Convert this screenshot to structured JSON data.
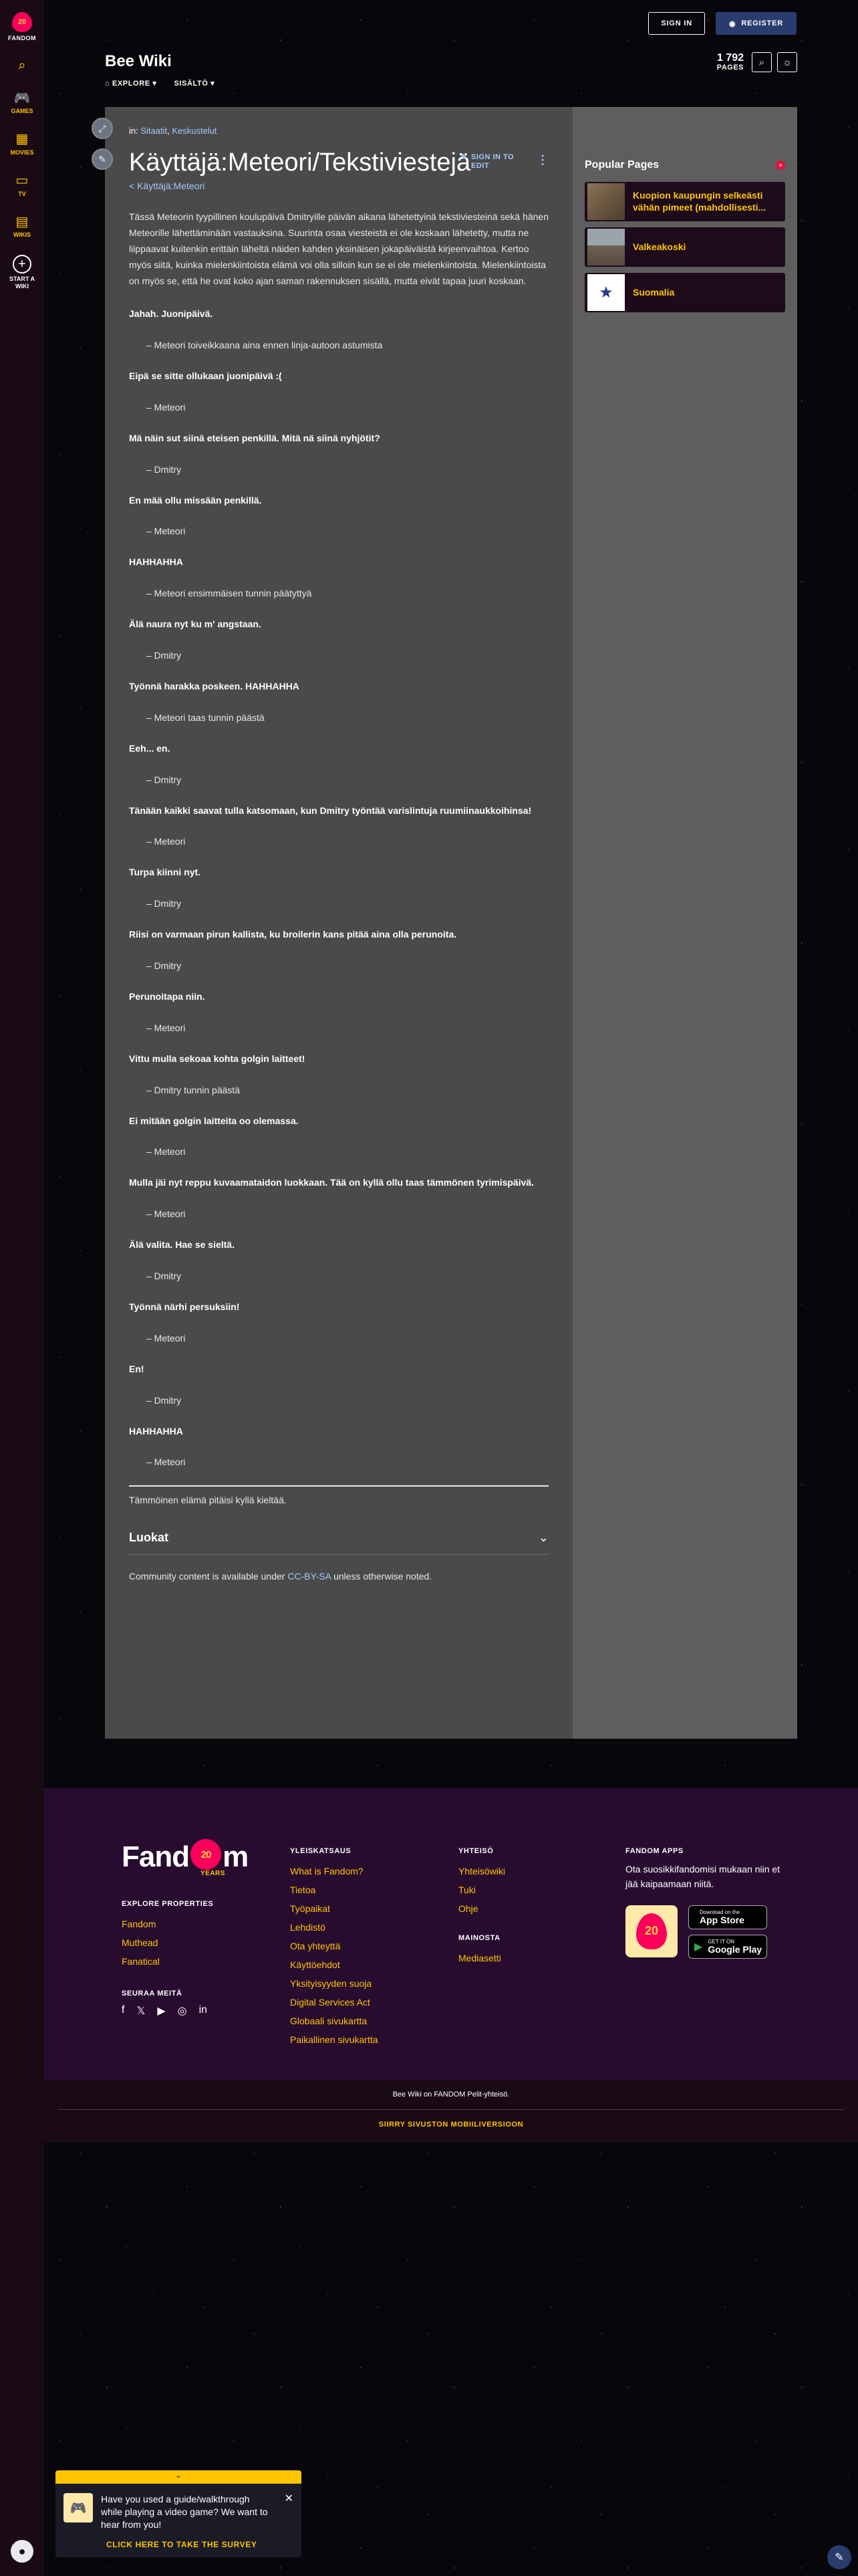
{
  "rail": {
    "logo_label": "FANDOM",
    "logo_badge": "20",
    "items": [
      {
        "label": "",
        "icon": "search-icon",
        "glyph": "⌕"
      },
      {
        "label": "GAMES",
        "icon": "gamepad-icon",
        "glyph": "🎮"
      },
      {
        "label": "MOVIES",
        "icon": "movies-icon",
        "glyph": "▦"
      },
      {
        "label": "TV",
        "icon": "tv-icon",
        "glyph": "▭"
      },
      {
        "label": "WIKIS",
        "icon": "wikis-icon",
        "glyph": "▤"
      }
    ],
    "start_label_1": "START A",
    "start_label_2": "WIKI",
    "start_glyph": "+"
  },
  "auth": {
    "signin": "SIGN IN",
    "register": "REGISTER"
  },
  "wiki": {
    "name": "Bee Wiki",
    "nav_explore": "EXPLORE ▾",
    "nav_content": "SISÄLTÖ ▾",
    "pages_num": "1 792",
    "pages_word": "PAGES"
  },
  "article": {
    "in_label": "in:",
    "cat1": "Sitaatit",
    "cat2": "Keskustelut",
    "title": "Käyttäjä:Meteori/Tekstiviestejä",
    "edit_label": "SIGN IN TO EDIT",
    "back_link": "< Käyttäjä:Meteori",
    "intro": "Tässä Meteorin tyypillinen koulupäivä Dmitryille päivän aikana lähetettyinä tekstiviesteinä sekä hänen Meteorille lähettäminään vastauksina. Suurinta osaa viesteistä ei ole koskaan lähetetty, mutta ne liippaavat kuitenkin erittäin läheltä näiden kahden yksinäisen jokapäiväistä kirjeenvaihtoa. Kertoo myös siitä, kuinka mielenkiintoista elämä voi olla silloin kun se ei ole mielenkiintoista. Mielenkiintoista on myös se, että he ovat koko ajan saman rakennuksen sisällä, mutta eivät tapaa juuri koskaan.",
    "dialogue": [
      {
        "q": "Jahah. Juonipäivä.",
        "a": "– Meteori toiveikkaana aina ennen linja-autoon astumista"
      },
      {
        "q": "Eipä se sitte ollukaan juonipäivä :(",
        "a": "– Meteori"
      },
      {
        "q": "Mä näin sut siinä eteisen penkillä. Mitä nä siinä nyhjötit?",
        "a": "– Dmitry"
      },
      {
        "q": "En mää ollu missään penkillä.",
        "a": "– Meteori"
      },
      {
        "q": "HAHHAHHA",
        "a": "– Meteori ensimmäisen tunnin päätyttyä"
      },
      {
        "q": "Älä naura nyt ku m' angstaan.",
        "a": "– Dmitry"
      },
      {
        "q": "Työnnä harakka poskeen. HAHHAHHA",
        "a": "– Meteori taas tunnin päästä"
      },
      {
        "q": "Eeh... en.",
        "a": "– Dmitry"
      },
      {
        "q": "Tänään kaikki saavat tulla katsomaan, kun Dmitry työntää varislintuja ruumiinaukkoihinsa!",
        "a": "– Meteori"
      },
      {
        "q": "Turpa kiinni nyt.",
        "a": "– Dmitry"
      },
      {
        "q": "Riisi on varmaan pirun kallista, ku broilerin kans pitää aina olla perunoita.",
        "a": "– Dmitry"
      },
      {
        "q": "Perunoitapa niin.",
        "a": "– Meteori"
      },
      {
        "q": "Vittu mulla sekoaa kohta golgin laitteet!",
        "a": "– Dmitry tunnin päästä"
      },
      {
        "q": "Ei mitään golgin laitteita oo olemassa.",
        "a": "– Meteori"
      },
      {
        "q": "Mulla jäi nyt reppu kuvaamataidon luokkaan. Tää on kyllä ollu taas tämmönen tyrimispäivä.",
        "a": "– Meteori"
      },
      {
        "q": "Älä valita. Hae se sieltä.",
        "a": "– Dmitry"
      },
      {
        "q": "Työnnä närhi persuksiin!",
        "a": "– Meteori"
      },
      {
        "q": "En!",
        "a": "– Dmitry"
      },
      {
        "q": "HAHHAHHA",
        "a": "– Meteori"
      }
    ],
    "outro": "Tämmöinen elämä pitäisi kyllä kieltää.",
    "categories_heading": "Luokat",
    "license_pre": "Community content is available under ",
    "license_link": "CC-BY-SA",
    "license_post": " unless otherwise noted."
  },
  "popular": {
    "title": "Popular Pages",
    "items": [
      {
        "label": "Kuopion kaupungin selkeästi vähän pimeet (mahdollisesti...",
        "thumb_color": "#6b5a44"
      },
      {
        "label": "Valkeakoski",
        "thumb_color": "#7a6a58"
      },
      {
        "label": "Suomalia",
        "thumb_color": "#ffffff"
      }
    ]
  },
  "footer": {
    "logo": "Fandom",
    "logo_badge": "20",
    "years": "YEARS",
    "explore_h": "EXPLORE PROPERTIES",
    "explore": [
      "Fandom",
      "Muthead",
      "Fanatical"
    ],
    "follow_h": "SEURAA MEITÄ",
    "overview_h": "YLEISKATSAUS",
    "overview": [
      "What is Fandom?",
      "Tietoa",
      "Työpaikat",
      "Lehdistö",
      "Ota yhteyttä",
      "Käyttöehdot",
      "Yksityisyyden suoja",
      "Digital Services Act",
      "Globaali sivukartta",
      "Paikallinen sivukartta"
    ],
    "community_h": "YHTEISÖ",
    "community": [
      "Yhteisöwiki",
      "Tuki",
      "Ohje"
    ],
    "advertise_h": "MAINOSTA",
    "advertise": [
      "Mediasetti"
    ],
    "apps_h": "FANDOM APPS",
    "apps_text": "Ota suosikkifandomisi mukaan niin et jää kaipaamaan niitä.",
    "appstore_small": "Download on the",
    "appstore_big": "App Store",
    "gplay_small": "GET IT ON",
    "gplay_big": "Google Play",
    "bottom_line": "Bee Wiki on FANDOM Pelit-yhteisö.",
    "mobile": "SIIRRY SIVUSTON MOBIILIVERSIOON"
  },
  "survey": {
    "text": "Have you used a guide/walkthrough while playing a video game? We want to hear from you!",
    "cta": "CLICK HERE TO TAKE THE SURVEY"
  }
}
